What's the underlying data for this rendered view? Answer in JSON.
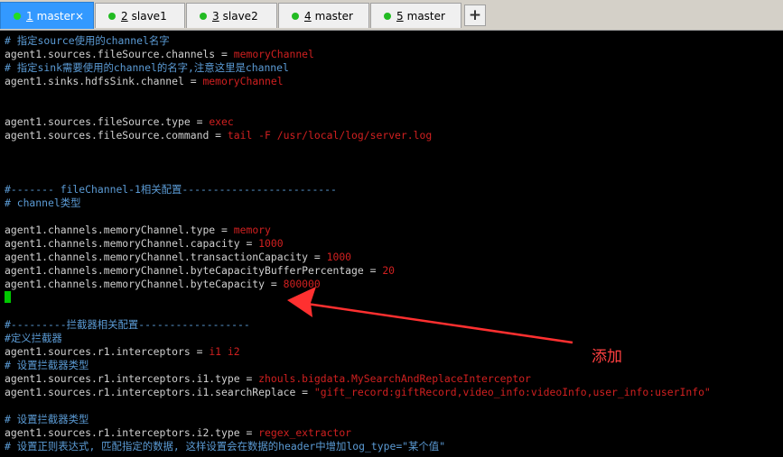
{
  "tabs": [
    {
      "num": "1",
      "label": "master",
      "active": true
    },
    {
      "num": "2",
      "label": "slave1",
      "active": false
    },
    {
      "num": "3",
      "label": "slave2",
      "active": false
    },
    {
      "num": "4",
      "label": "master",
      "active": false
    },
    {
      "num": "5",
      "label": "master",
      "active": false
    }
  ],
  "tab_close_glyph": "×",
  "add_tab_glyph": "+",
  "lines": [
    {
      "c": "# 指定source使用的channel名字"
    },
    {
      "k": "agent1.sources.fileSource.channels = ",
      "v": "memoryChannel"
    },
    {
      "c": "# 指定sink需要使用的channel的名字,注意这里是channel"
    },
    {
      "k": "agent1.sinks.hdfsSink.channel = ",
      "v": "memoryChannel"
    },
    {},
    {},
    {
      "k": "agent1.sources.fileSource.type = ",
      "v": "exec"
    },
    {
      "k": "agent1.sources.fileSource.command = ",
      "v": "tail -F /usr/local/log/server.log"
    },
    {},
    {},
    {},
    {
      "c": "#------- fileChannel-1相关配置-------------------------"
    },
    {
      "c": "# channel类型"
    },
    {},
    {
      "k": "agent1.channels.memoryChannel.type = ",
      "v": "memory"
    },
    {
      "k": "agent1.channels.memoryChannel.capacity = ",
      "v": "1000"
    },
    {
      "k": "agent1.channels.memoryChannel.transactionCapacity = ",
      "v": "1000"
    },
    {
      "k": "agent1.channels.memoryChannel.byteCapacityBufferPercentage = ",
      "v": "20"
    },
    {
      "k": "agent1.channels.memoryChannel.byteCapacity = ",
      "v": "800000"
    },
    {},
    {},
    {
      "c": "#---------拦截器相关配置------------------"
    },
    {
      "c": "#定义拦截器"
    },
    {
      "k": "agent1.sources.r1.interceptors = ",
      "v": "i1 i2"
    },
    {
      "c": "# 设置拦截器类型"
    },
    {
      "k": "agent1.sources.r1.interceptors.i1.type = ",
      "v": "zhouls.bigdata.MySearchAndReplaceInterceptor"
    },
    {
      "k": "agent1.sources.r1.interceptors.i1.searchReplace = ",
      "v": "\"gift_record:giftRecord,video_info:videoInfo,user_info:userInfo\""
    },
    {},
    {
      "c": "# 设置拦截器类型"
    },
    {
      "k": "agent1.sources.r1.interceptors.i2.type = ",
      "v": "regex_extractor"
    },
    {
      "c": "# 设置正则表达式, 匹配指定的数据, 这样设置会在数据的header中增加log_type=\"某个值\""
    }
  ],
  "annotation": {
    "label": "添加",
    "color": "#ff3030"
  }
}
